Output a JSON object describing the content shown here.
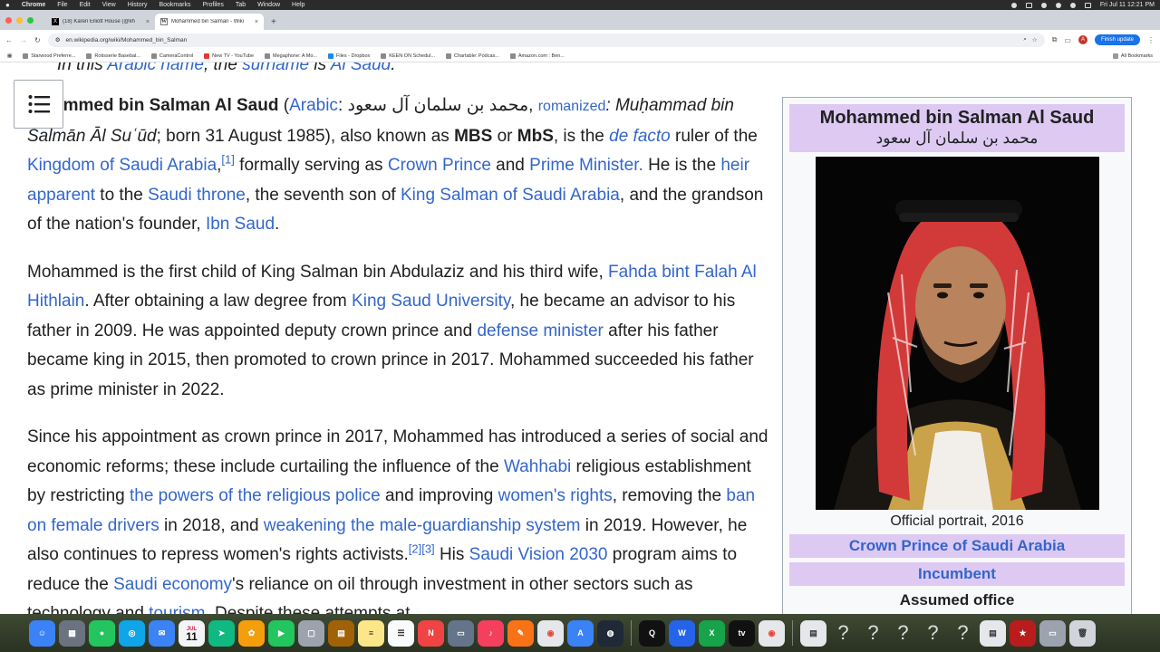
{
  "menubar": {
    "apple": "",
    "app": "Chrome",
    "items": [
      "File",
      "Edit",
      "View",
      "History",
      "Bookmarks",
      "Profiles",
      "Tab",
      "Window",
      "Help"
    ],
    "clock": "Fri Jul 11  12:21 PM"
  },
  "tabs": [
    {
      "label": "(18) Karen Elliott House (@kh",
      "favicon": "x-icon"
    },
    {
      "label": "Mohammed bin Salman - Wiki",
      "favicon": "wikipedia-icon"
    }
  ],
  "address": {
    "url": "en.wikipedia.org/wiki/Mohammed_bin_Salman",
    "avatar": "A",
    "finish_update": "Finish update"
  },
  "bookmarks": [
    "Starwood Preferre...",
    "Rotisserie Basebal...",
    "CameraControl",
    "New TV - YouTube",
    "Megaphone: A Mo...",
    "Files - Dropbox",
    "KEEN ON Schedul...",
    "Chartable: Podcas...",
    "Amazon.com : Ben..."
  ],
  "all_bookmarks": "All Bookmarks",
  "article": {
    "hatnote": {
      "pre": "In this ",
      "link1": "Arabic name",
      "mid": ", the ",
      "link2": "surname",
      "post": " is ",
      "link3": "Al Saud",
      "end": "."
    },
    "p1": {
      "name": "ammed bin Salman Al Saud",
      "open": " (",
      "arabic_link": "Arabic",
      "arabic_text": ": محمد بن سلمان آل سعود, ",
      "romanized_link": "romanized",
      "romanized": ": Muḥammad bin Salmān Āl Suʿūd",
      "born": "; born 31 August 1985), also known as ",
      "mbs": "MBS",
      "or": " or ",
      "mbs2": "MbS",
      "is_the": ", is the ",
      "de_facto": "de facto",
      "ruler": " ruler of the ",
      "ksa": "Kingdom of Saudi Arabia",
      "comma": ",",
      "ref1": "[1]",
      "formally": " formally serving as ",
      "crown": "Crown Prince",
      "and": " and ",
      "pm": "Prime Minister.",
      "heis": " He is the ",
      "heir": "heir apparent",
      "tothe": " to the ",
      "throne": "Saudi throne",
      "seventh": ", the seventh son of ",
      "king": "King Salman of Saudi Arabia",
      "grandson": ", and the grandson of the nation's founder, ",
      "ibn": "Ibn Saud",
      "dot": "."
    },
    "p2": {
      "t1": "Mohammed is the first child of King Salman bin Abdulaziz and his third wife, ",
      "fahda": "Fahda bint Falah Al Hithlain",
      "t2": ". After obtaining a law degree from ",
      "ksu": "King Saud University",
      "t3": ", he became an advisor to his father in 2009. He was appointed deputy crown prince and ",
      "defense": "defense minister",
      "t4": " after his father became king in 2015, then promoted to crown prince in 2017. Mohammed succeeded his father as prime minister in 2022."
    },
    "p3": {
      "t1": "Since his appointment as crown prince in 2017, Mohammed has introduced a series of social and economic reforms; these include curtailing the influence of the ",
      "wahhabi": "Wahhabi",
      "t2": " religious establishment by restricting ",
      "police": "the powers of the religious police",
      "t3": " and improving ",
      "women": "women's rights",
      "t4": ", removing the ",
      "ban": "ban on female drivers",
      "t5": " in 2018, and ",
      "guardianship": "weakening the male-guardianship system",
      "t6": " in 2019. However, he also continues to repress women's rights activists.",
      "ref23": "[2][3]",
      "t7": " His ",
      "vision": "Saudi Vision 2030",
      "t8": " program aims to reduce the ",
      "economy": "Saudi economy",
      "t9": "'s reliance on oil through investment in other sectors such as technology and ",
      "tourism": "tourism",
      "t10": ". Despite these attempts at"
    }
  },
  "infobox": {
    "title": "Mohammed bin Salman Al Saud",
    "title_ar": "محمد بن سلمان آل سعود",
    "caption": "Official portrait, 2016",
    "office": "Crown Prince of Saudi Arabia",
    "status": "Incumbent",
    "assumed": "Assumed office"
  },
  "dock": {
    "calendar_month": "JUL",
    "calendar_day": "11"
  }
}
